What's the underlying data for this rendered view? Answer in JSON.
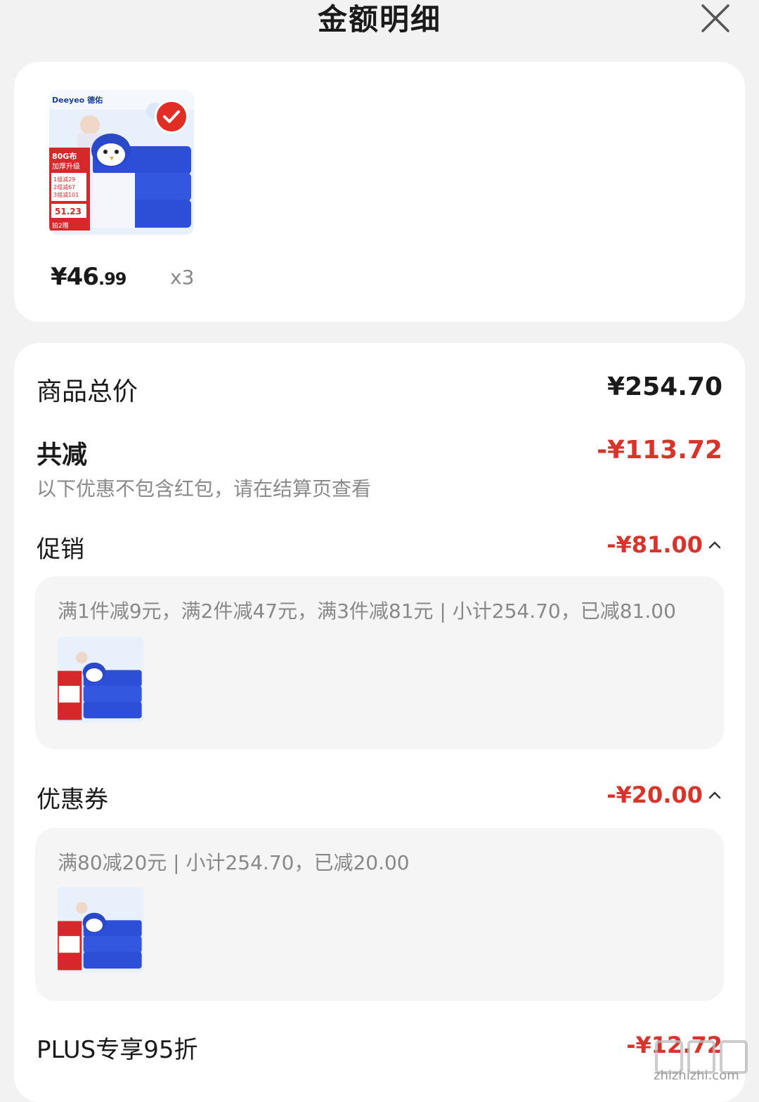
{
  "header": {
    "title": "金额明细"
  },
  "product": {
    "brand": "Deeyeo 德佑",
    "promo_lines": [
      "80G布",
      "加厚升级",
      "1组减29",
      "2组减67",
      "3组减101",
      "51.23",
      "拍2赠"
    ],
    "price_main": "¥46",
    "price_cents": ".99",
    "quantity": "x3"
  },
  "summary": {
    "total_label": "商品总价",
    "total_value": "¥254.70",
    "discount_label": "共减",
    "discount_value": "-¥113.72",
    "note": "以下优惠不包含红包，请在结算页查看"
  },
  "promotion": {
    "label": "促销",
    "value": "-¥81.00",
    "detail": "满1件减9元，满2件减47元，满3件减81元 | 小计254.70，已减81.00"
  },
  "coupon": {
    "label": "优惠券",
    "value": "-¥20.00",
    "detail": "满80减20元 | 小计254.70，已减20.00"
  },
  "plus": {
    "label": "PLUS专享95折",
    "value": "-¥12.72"
  },
  "watermark": {
    "text": "zhizhizhi.com"
  },
  "colors": {
    "accent_red": "#d7352b",
    "background": "#f2f2f2",
    "card": "#ffffff"
  }
}
